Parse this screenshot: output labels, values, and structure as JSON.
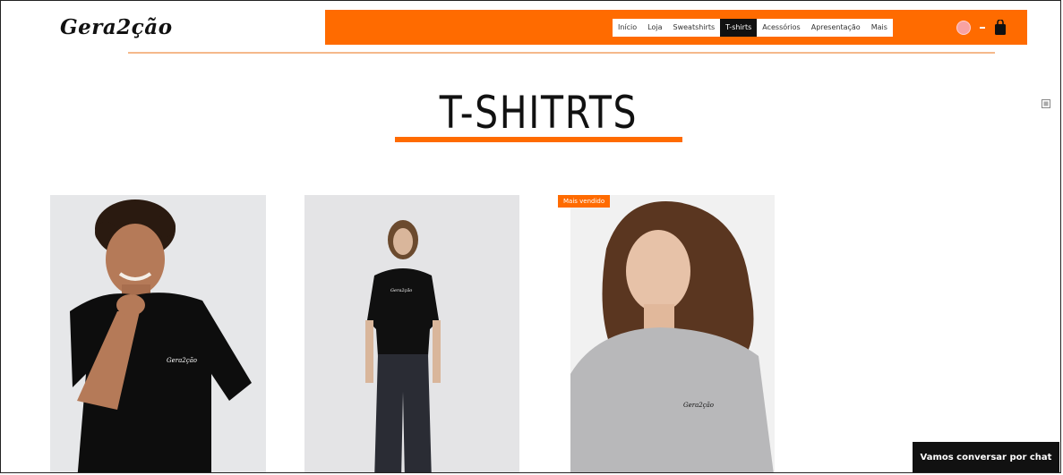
{
  "header": {
    "logo_text": "Gera2ção",
    "nav": [
      {
        "label": "Início",
        "active": false
      },
      {
        "label": "Loja",
        "active": false
      },
      {
        "label": "Sweatshirts",
        "active": false
      },
      {
        "label": "T-shirts",
        "active": true
      },
      {
        "label": "Acessórios",
        "active": false
      },
      {
        "label": "Apresentação",
        "active": false
      },
      {
        "label": "Mais",
        "active": false
      }
    ],
    "icons": [
      "language-flag-icon",
      "dropdown-dash-icon",
      "shopping-bag-icon"
    ]
  },
  "page": {
    "title": "T-SHITRTS"
  },
  "products": [
    {
      "image": "man-black-tshirt-photo",
      "shirt_print": "Gera2ção"
    },
    {
      "image": "woman-black-tshirt-photo",
      "shirt_print": "Gera2ção"
    },
    {
      "image": "woman-grey-tshirt-photo",
      "shirt_print": "Gera2ção",
      "badge": "Mais vendido"
    }
  ],
  "chat": {
    "label": "Vamos conversar por chat"
  },
  "colors": {
    "brand_orange": "#ff6b00",
    "dark": "#111111"
  }
}
